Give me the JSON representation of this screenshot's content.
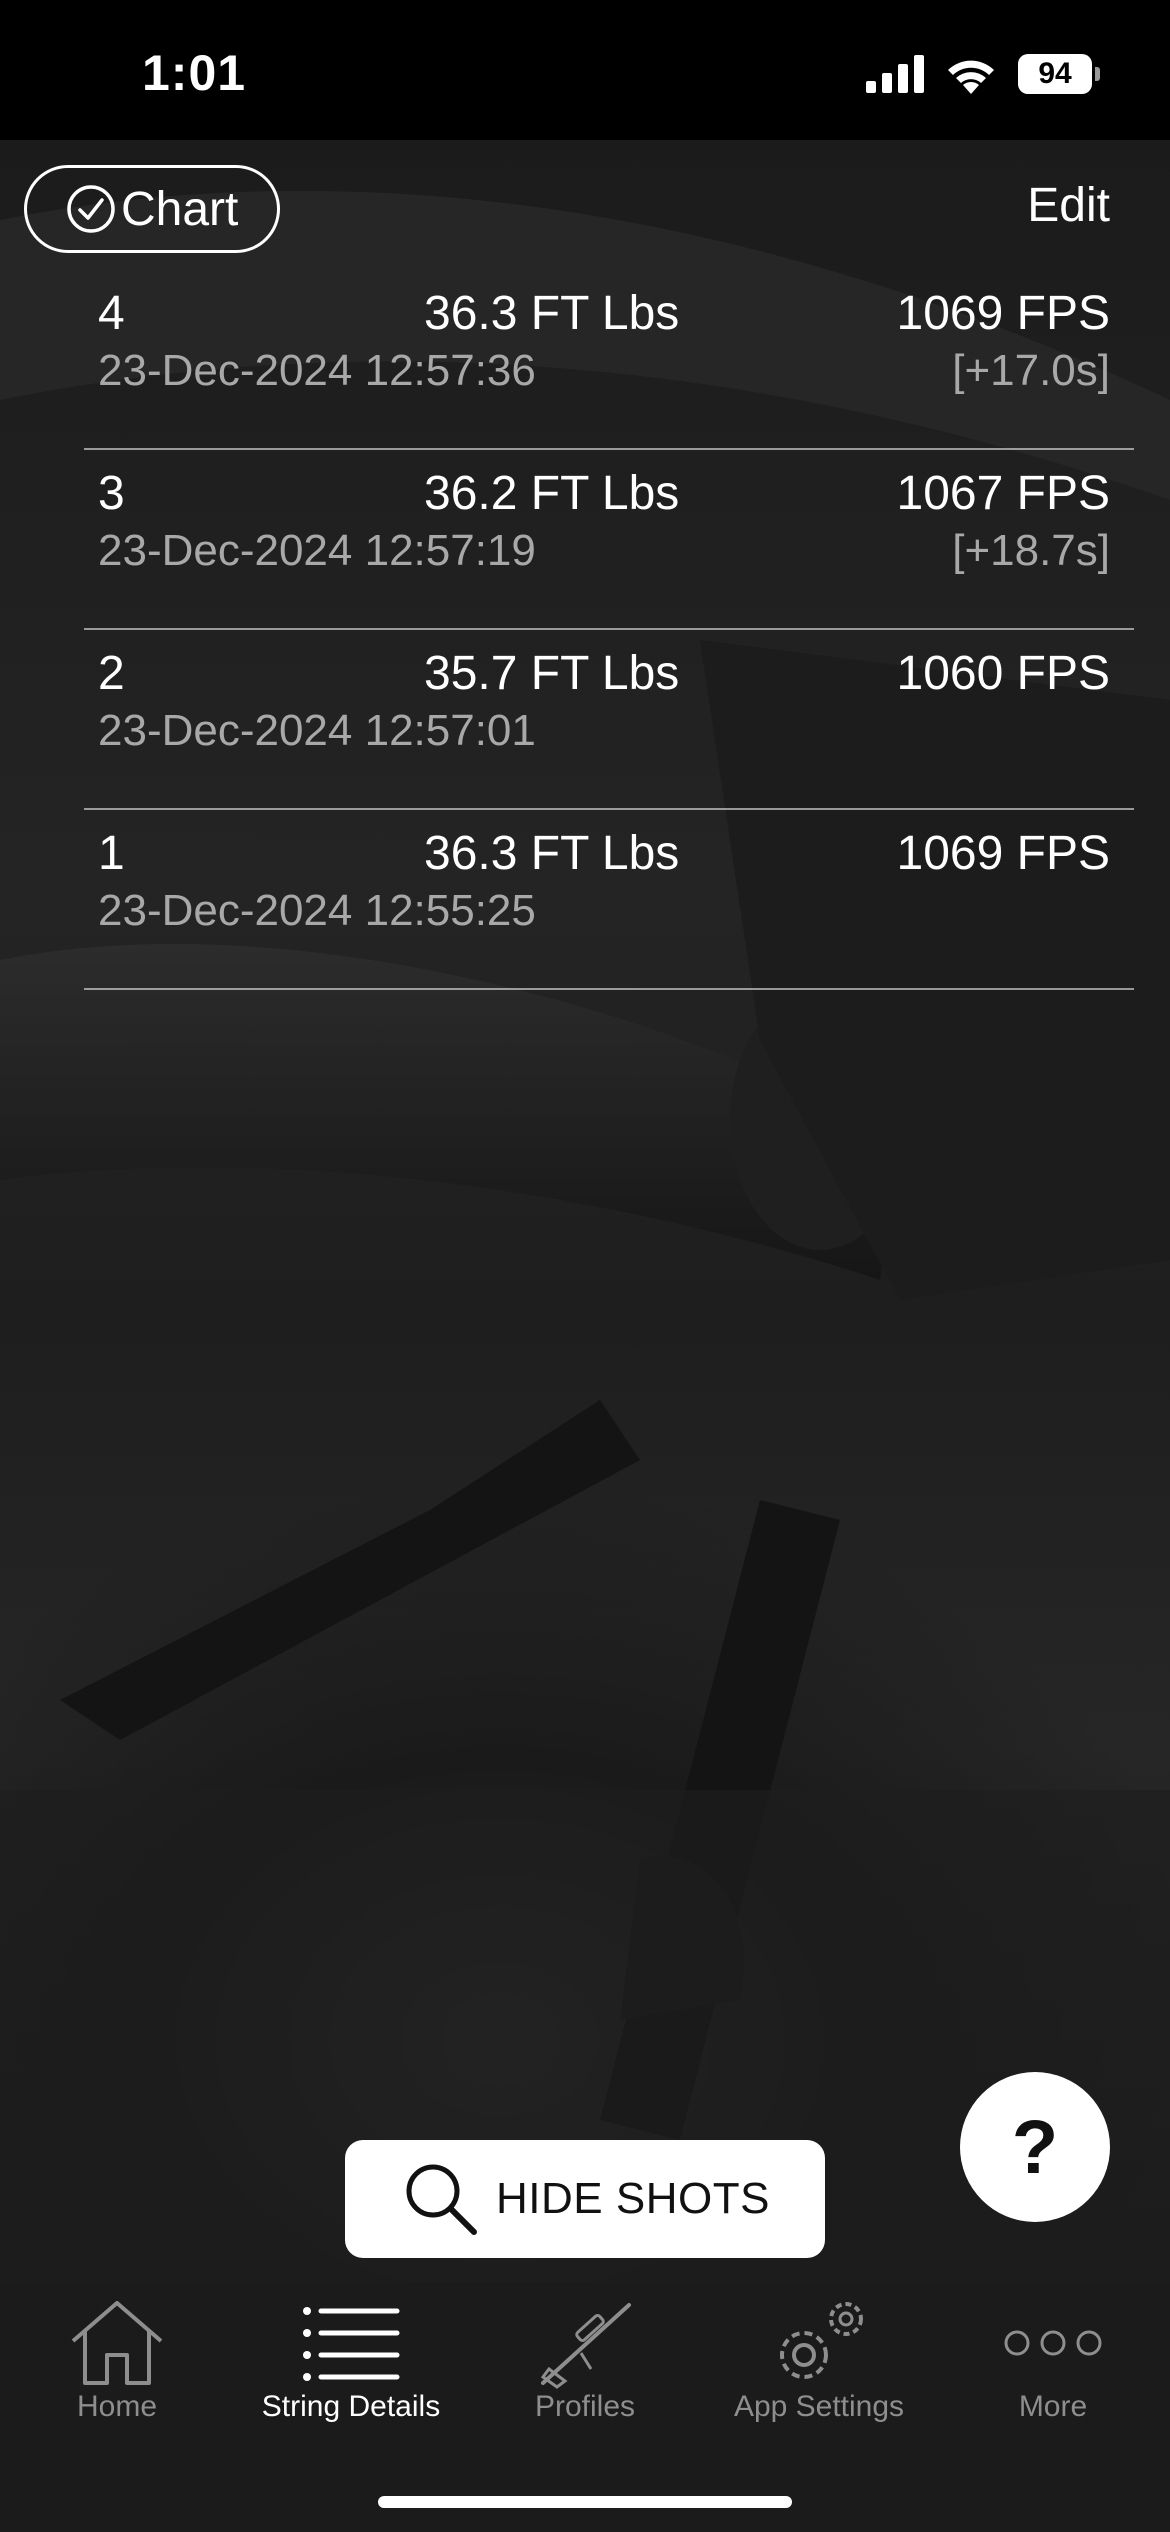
{
  "status_bar": {
    "time": "1:01",
    "battery": "94"
  },
  "header": {
    "chart_label": "Chart",
    "edit_label": "Edit"
  },
  "shots": [
    {
      "number": "4",
      "energy": "36.3 FT Lbs",
      "velocity": "1069 FPS",
      "timestamp": "23-Dec-2024 12:57:36",
      "interval": "[+17.0s]"
    },
    {
      "number": "3",
      "energy": "36.2 FT Lbs",
      "velocity": "1067 FPS",
      "timestamp": "23-Dec-2024 12:57:19",
      "interval": "[+18.7s]"
    },
    {
      "number": "2",
      "energy": "35.7 FT Lbs",
      "velocity": "1060 FPS",
      "timestamp": "23-Dec-2024 12:57:01",
      "interval": ""
    },
    {
      "number": "1",
      "energy": "36.3 FT Lbs",
      "velocity": "1069 FPS",
      "timestamp": "23-Dec-2024 12:55:25",
      "interval": ""
    }
  ],
  "actions": {
    "hide_shots_label": "HIDE SHOTS",
    "help_label": "?"
  },
  "tabs": [
    {
      "label": "Home",
      "icon": "home-icon",
      "active": false
    },
    {
      "label": "String Details",
      "icon": "list-icon",
      "active": true
    },
    {
      "label": "Profiles",
      "icon": "rifle-icon",
      "active": false
    },
    {
      "label": "App Settings",
      "icon": "gears-icon",
      "active": false
    },
    {
      "label": "More",
      "icon": "more-dots-icon",
      "active": false
    }
  ],
  "colors": {
    "background": "#000000",
    "tab_bar": "#1b1b1b",
    "inactive_tab": "#8e8e8e",
    "secondary_text": "#a8a8a8"
  }
}
